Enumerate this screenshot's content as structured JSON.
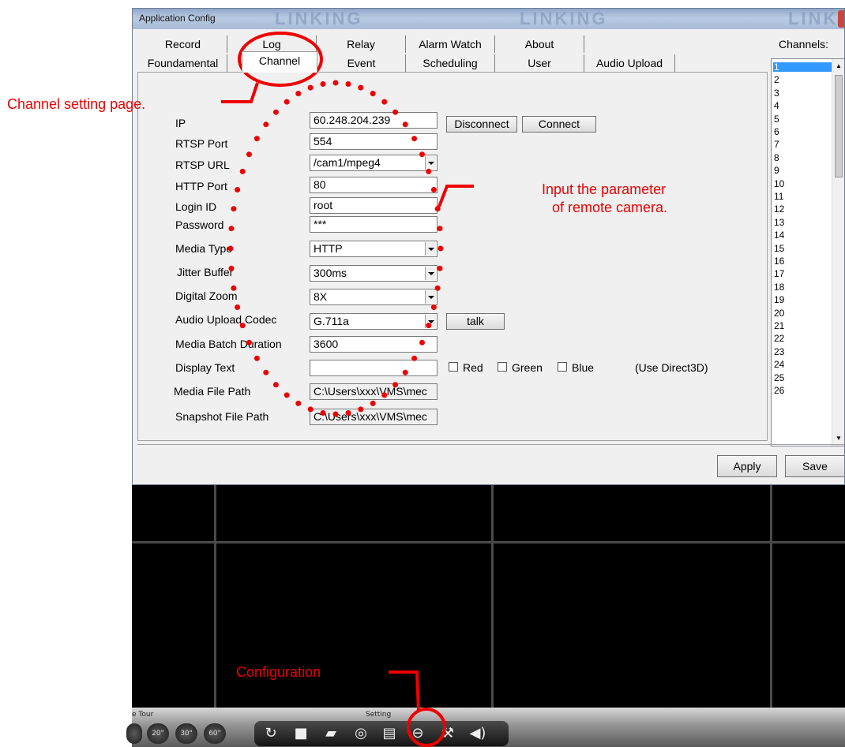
{
  "dialog": {
    "title": "Application Config",
    "watermark": "LINKING",
    "tabs_row1": [
      "Record",
      "Log",
      "Relay",
      "Alarm Watch",
      "About"
    ],
    "tabs_row2": [
      "Foundamental",
      "Channel",
      "Event",
      "Scheduling",
      "User",
      "Audio Upload"
    ],
    "selected_tab": "Channel",
    "channels_label": "Channels:",
    "channels": [
      "1",
      "2",
      "3",
      "4",
      "5",
      "6",
      "7",
      "8",
      "9",
      "10",
      "11",
      "12",
      "13",
      "14",
      "15",
      "16",
      "17",
      "18",
      "19",
      "20",
      "21",
      "22",
      "23",
      "24",
      "25",
      "26"
    ],
    "selected_channel": "1",
    "fields": {
      "ip": {
        "label": "IP",
        "value": "60.248.204.239"
      },
      "rtsp_port": {
        "label": "RTSP Port",
        "value": "554"
      },
      "rtsp_url": {
        "label": "RTSP URL",
        "value": "/cam1/mpeg4"
      },
      "http_port": {
        "label": "HTTP Port",
        "value": "80"
      },
      "login_id": {
        "label": "Login ID",
        "value": "root"
      },
      "password": {
        "label": "Password",
        "value": "***"
      },
      "media_type": {
        "label": "Media Type",
        "value": "HTTP"
      },
      "jitter_buffer": {
        "label": "Jitter Buffer",
        "value": "300ms"
      },
      "digital_zoom": {
        "label": "Digital Zoom",
        "value": "8X"
      },
      "audio_codec": {
        "label": "Audio Upload Codec",
        "value": "G.711a"
      },
      "batch_duration": {
        "label": "Media Batch Duration",
        "value": "3600"
      },
      "display_text": {
        "label": "Display Text",
        "value": ""
      },
      "media_path": {
        "label": "Media File Path",
        "value": "C:\\Users\\xxx\\VMS\\mec"
      },
      "snapshot_path": {
        "label": "Snapshot File Path",
        "value": "C:\\Users\\xxx\\VMS\\mec"
      }
    },
    "buttons": {
      "disconnect": "Disconnect",
      "connect": "Connect",
      "talk": "talk",
      "apply": "Apply",
      "save": "Save"
    },
    "color_options": {
      "red": "Red",
      "green": "Green",
      "blue": "Blue",
      "note": "(Use Direct3D)"
    }
  },
  "toolbar": {
    "tour_label": "e Tour",
    "setting_label": "Setting",
    "tour_buttons": [
      "20\"",
      "30\"",
      "60\""
    ],
    "icons": [
      "refresh-icon",
      "lock-icon",
      "folder-icon",
      "globe-icon",
      "document-icon",
      "minus-circle-icon",
      "wrench-icon",
      "speaker-icon"
    ]
  },
  "annotations": {
    "channel_page": "Channel setting page.",
    "input_param_1": "Input the parameter",
    "input_param_2": "of remote camera.",
    "configuration": "Configuration"
  },
  "colors": {
    "annotation": "#e00000",
    "selection": "#3399ff"
  }
}
